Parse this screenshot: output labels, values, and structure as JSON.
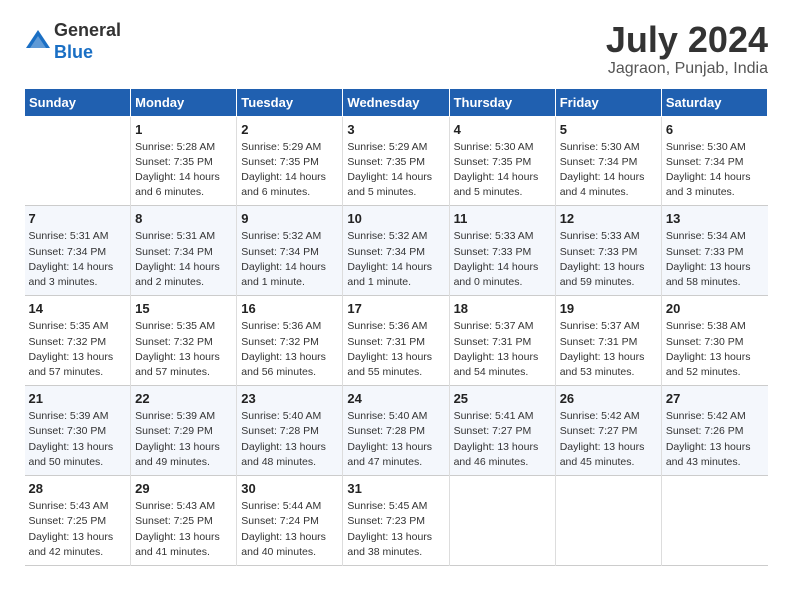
{
  "header": {
    "logo_line1": "General",
    "logo_line2": "Blue",
    "month_title": "July 2024",
    "location": "Jagraon, Punjab, India"
  },
  "weekdays": [
    "Sunday",
    "Monday",
    "Tuesday",
    "Wednesday",
    "Thursday",
    "Friday",
    "Saturday"
  ],
  "weeks": [
    [
      {
        "num": "",
        "info": ""
      },
      {
        "num": "1",
        "info": "Sunrise: 5:28 AM\nSunset: 7:35 PM\nDaylight: 14 hours\nand 6 minutes."
      },
      {
        "num": "2",
        "info": "Sunrise: 5:29 AM\nSunset: 7:35 PM\nDaylight: 14 hours\nand 6 minutes."
      },
      {
        "num": "3",
        "info": "Sunrise: 5:29 AM\nSunset: 7:35 PM\nDaylight: 14 hours\nand 5 minutes."
      },
      {
        "num": "4",
        "info": "Sunrise: 5:30 AM\nSunset: 7:35 PM\nDaylight: 14 hours\nand 5 minutes."
      },
      {
        "num": "5",
        "info": "Sunrise: 5:30 AM\nSunset: 7:34 PM\nDaylight: 14 hours\nand 4 minutes."
      },
      {
        "num": "6",
        "info": "Sunrise: 5:30 AM\nSunset: 7:34 PM\nDaylight: 14 hours\nand 3 minutes."
      }
    ],
    [
      {
        "num": "7",
        "info": "Sunrise: 5:31 AM\nSunset: 7:34 PM\nDaylight: 14 hours\nand 3 minutes."
      },
      {
        "num": "8",
        "info": "Sunrise: 5:31 AM\nSunset: 7:34 PM\nDaylight: 14 hours\nand 2 minutes."
      },
      {
        "num": "9",
        "info": "Sunrise: 5:32 AM\nSunset: 7:34 PM\nDaylight: 14 hours\nand 1 minute."
      },
      {
        "num": "10",
        "info": "Sunrise: 5:32 AM\nSunset: 7:34 PM\nDaylight: 14 hours\nand 1 minute."
      },
      {
        "num": "11",
        "info": "Sunrise: 5:33 AM\nSunset: 7:33 PM\nDaylight: 14 hours\nand 0 minutes."
      },
      {
        "num": "12",
        "info": "Sunrise: 5:33 AM\nSunset: 7:33 PM\nDaylight: 13 hours\nand 59 minutes."
      },
      {
        "num": "13",
        "info": "Sunrise: 5:34 AM\nSunset: 7:33 PM\nDaylight: 13 hours\nand 58 minutes."
      }
    ],
    [
      {
        "num": "14",
        "info": "Sunrise: 5:35 AM\nSunset: 7:32 PM\nDaylight: 13 hours\nand 57 minutes."
      },
      {
        "num": "15",
        "info": "Sunrise: 5:35 AM\nSunset: 7:32 PM\nDaylight: 13 hours\nand 57 minutes."
      },
      {
        "num": "16",
        "info": "Sunrise: 5:36 AM\nSunset: 7:32 PM\nDaylight: 13 hours\nand 56 minutes."
      },
      {
        "num": "17",
        "info": "Sunrise: 5:36 AM\nSunset: 7:31 PM\nDaylight: 13 hours\nand 55 minutes."
      },
      {
        "num": "18",
        "info": "Sunrise: 5:37 AM\nSunset: 7:31 PM\nDaylight: 13 hours\nand 54 minutes."
      },
      {
        "num": "19",
        "info": "Sunrise: 5:37 AM\nSunset: 7:31 PM\nDaylight: 13 hours\nand 53 minutes."
      },
      {
        "num": "20",
        "info": "Sunrise: 5:38 AM\nSunset: 7:30 PM\nDaylight: 13 hours\nand 52 minutes."
      }
    ],
    [
      {
        "num": "21",
        "info": "Sunrise: 5:39 AM\nSunset: 7:30 PM\nDaylight: 13 hours\nand 50 minutes."
      },
      {
        "num": "22",
        "info": "Sunrise: 5:39 AM\nSunset: 7:29 PM\nDaylight: 13 hours\nand 49 minutes."
      },
      {
        "num": "23",
        "info": "Sunrise: 5:40 AM\nSunset: 7:28 PM\nDaylight: 13 hours\nand 48 minutes."
      },
      {
        "num": "24",
        "info": "Sunrise: 5:40 AM\nSunset: 7:28 PM\nDaylight: 13 hours\nand 47 minutes."
      },
      {
        "num": "25",
        "info": "Sunrise: 5:41 AM\nSunset: 7:27 PM\nDaylight: 13 hours\nand 46 minutes."
      },
      {
        "num": "26",
        "info": "Sunrise: 5:42 AM\nSunset: 7:27 PM\nDaylight: 13 hours\nand 45 minutes."
      },
      {
        "num": "27",
        "info": "Sunrise: 5:42 AM\nSunset: 7:26 PM\nDaylight: 13 hours\nand 43 minutes."
      }
    ],
    [
      {
        "num": "28",
        "info": "Sunrise: 5:43 AM\nSunset: 7:25 PM\nDaylight: 13 hours\nand 42 minutes."
      },
      {
        "num": "29",
        "info": "Sunrise: 5:43 AM\nSunset: 7:25 PM\nDaylight: 13 hours\nand 41 minutes."
      },
      {
        "num": "30",
        "info": "Sunrise: 5:44 AM\nSunset: 7:24 PM\nDaylight: 13 hours\nand 40 minutes."
      },
      {
        "num": "31",
        "info": "Sunrise: 5:45 AM\nSunset: 7:23 PM\nDaylight: 13 hours\nand 38 minutes."
      },
      {
        "num": "",
        "info": ""
      },
      {
        "num": "",
        "info": ""
      },
      {
        "num": "",
        "info": ""
      }
    ]
  ]
}
